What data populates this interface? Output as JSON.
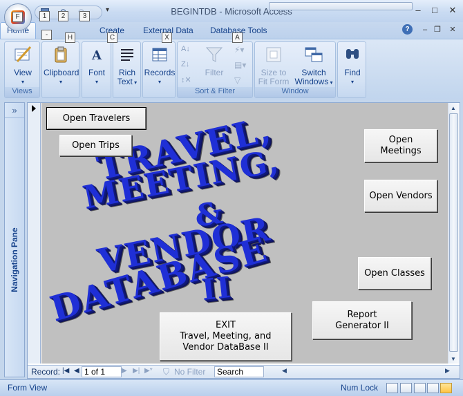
{
  "window": {
    "title": "BEGINTDB - Microsoft Access",
    "controls": {
      "minimize": "–",
      "maximize": "□",
      "close": "✕"
    },
    "app_icon": "office-button-icon"
  },
  "qat": {
    "keytips": [
      "1",
      "2",
      "3"
    ],
    "more": "▾"
  },
  "tabs": [
    {
      "label": "Home",
      "keytip": "H",
      "active": true
    },
    {
      "label": "Create",
      "keytip": "C"
    },
    {
      "label": "External Data",
      "keytip": "X"
    },
    {
      "label": "Database Tools",
      "keytip": "A"
    }
  ],
  "office_keytip": "F",
  "ribbon_controls": {
    "minimize": "–",
    "restore": "❐",
    "close": "✕",
    "help": "?"
  },
  "ribbon": {
    "views": {
      "title": "Views",
      "view_label": "View"
    },
    "clipboard": {
      "label": "Clipboard"
    },
    "font": {
      "label": "Font"
    },
    "rich_text": {
      "label_line1": "Rich",
      "label_line2": "Text"
    },
    "records": {
      "label": "Records"
    },
    "sort_filter": {
      "title": "Sort & Filter",
      "filter_label": "Filter"
    },
    "window": {
      "title": "Window",
      "size_line1": "Size to",
      "size_line2": "Fit Form",
      "switch_line1": "Switch",
      "switch_line2": "Windows"
    },
    "find": {
      "label": "Find"
    }
  },
  "nav_pane": {
    "label": "Navigation Pane",
    "toggle": "»"
  },
  "form": {
    "buttons": {
      "open_travelers": "Open Travelers",
      "open_trips": "Open Trips",
      "open_meetings": "Open Meetings",
      "open_vendors": "Open Vendors",
      "open_classes": "Open Classes",
      "report_generator": "Report\nGenerator II",
      "exit": "EXIT\nTravel, Meeting, and\nVendor DataBase II"
    },
    "wordart": [
      "TRAVEL,",
      "MEETING,",
      "&",
      "VENDOR",
      "DATABASE",
      "II"
    ]
  },
  "record_nav": {
    "label": "Record:",
    "position": "1 of 1",
    "filter": "No Filter",
    "search_placeholder": "Search"
  },
  "status": {
    "left": "Form View",
    "num_lock": "Num Lock"
  }
}
